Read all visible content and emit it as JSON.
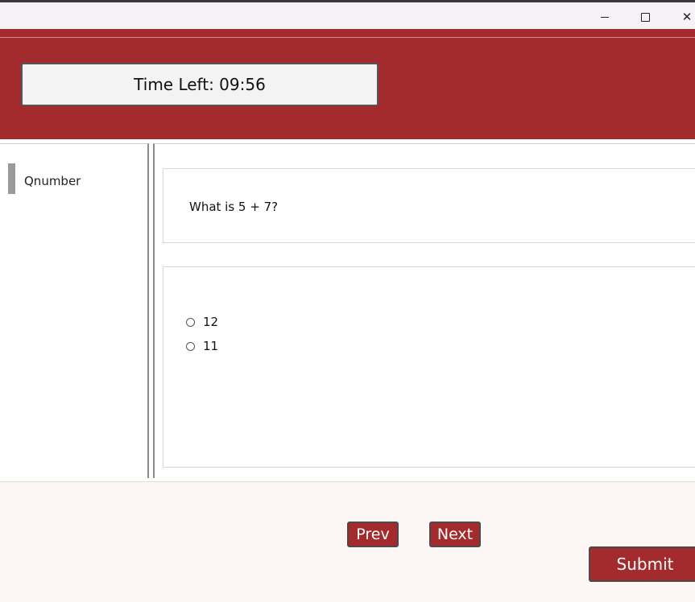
{
  "window": {
    "controls": {
      "minimize_icon": "minimize-icon",
      "maximize_icon": "maximize-icon",
      "close_icon": "close-icon",
      "close_glyph": "✕"
    }
  },
  "header": {
    "timer_text": "Time Left: 09:56",
    "background_color": "#a42b2d"
  },
  "sidebar": {
    "items": [
      {
        "label": "Qnumber"
      }
    ]
  },
  "question": {
    "text": "What is 5 + 7?"
  },
  "options": [
    {
      "label": "12",
      "selected": false
    },
    {
      "label": "11",
      "selected": false
    }
  ],
  "footer": {
    "prev_label": "Prev",
    "next_label": "Next",
    "submit_label": "Submit"
  }
}
